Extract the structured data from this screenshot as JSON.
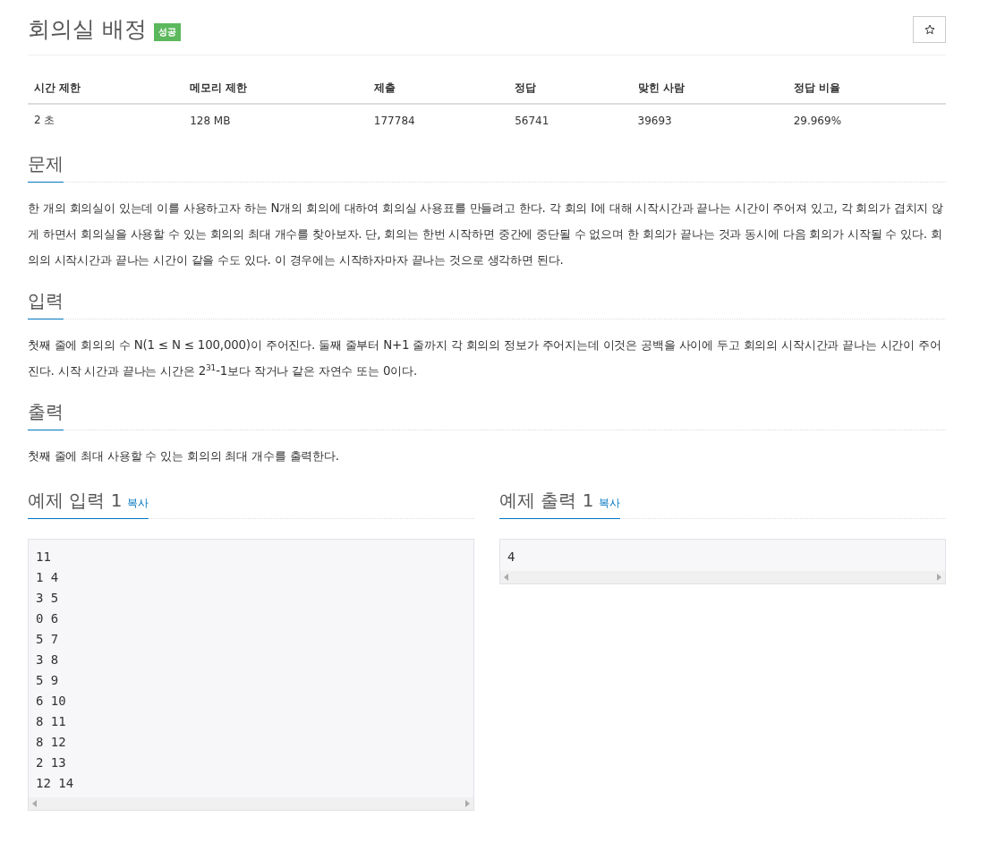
{
  "problem": {
    "title": "회의실 배정",
    "result_badge": "성공"
  },
  "info_table": {
    "columns": [
      "시간 제한",
      "메모리 제한",
      "제출",
      "정답",
      "맞힌 사람",
      "정답 비율"
    ],
    "rows": [
      [
        "2 초",
        "128 MB",
        "177784",
        "56741",
        "39693",
        "29.969%"
      ]
    ]
  },
  "sections": [
    {
      "heading": "문제",
      "body": "한 개의 회의실이 있는데 이를 사용하고자 하는 N개의 회의에 대하여 회의실 사용표를 만들려고 한다. 각 회의 I에 대해 시작시간과 끝나는 시간이 주어져 있고, 각 회의가 겹치지 않게 하면서 회의실을 사용할 수 있는 회의의 최대 개수를 찾아보자. 단, 회의는 한번 시작하면 중간에 중단될 수 없으며 한 회의가 끝나는 것과 동시에 다음 회의가 시작될 수 있다. 회의의 시작시간과 끝나는 시간이 같을 수도 있다. 이 경우에는 시작하자마자 끝나는 것으로 생각하면 된다."
    },
    {
      "heading": "입력",
      "body": "첫째 줄에 회의의 수 N(1 ≤ N ≤ 100,000)이 주어진다. 둘째 줄부터 N+1 줄까지 각 회의의 정보가 주어지는데 이것은 공백을 사이에 두고 회의의 시작시간과 끝나는 시간이 주어진다. 시작 시간과 끝나는 시간은 2$^{31}$-1보다 작거나 같은 자연수 또는 0이다."
    },
    {
      "heading": "출력",
      "body": "첫째 줄에 최대 사용할 수 있는 회의의 최대 개수를 출력한다."
    }
  ],
  "samples": [
    {
      "heading": "예제 입력 1",
      "copy_link": "복사",
      "lines": [
        "11",
        "1 4",
        "3 5",
        "0 6",
        "5 7",
        "3 8",
        "5 9",
        "6 10",
        "8 11",
        "8 12",
        "2 13",
        "12 14"
      ]
    },
    {
      "heading": "예제 출력 1",
      "copy_link": "복사",
      "lines": [
        "4"
      ]
    }
  ]
}
